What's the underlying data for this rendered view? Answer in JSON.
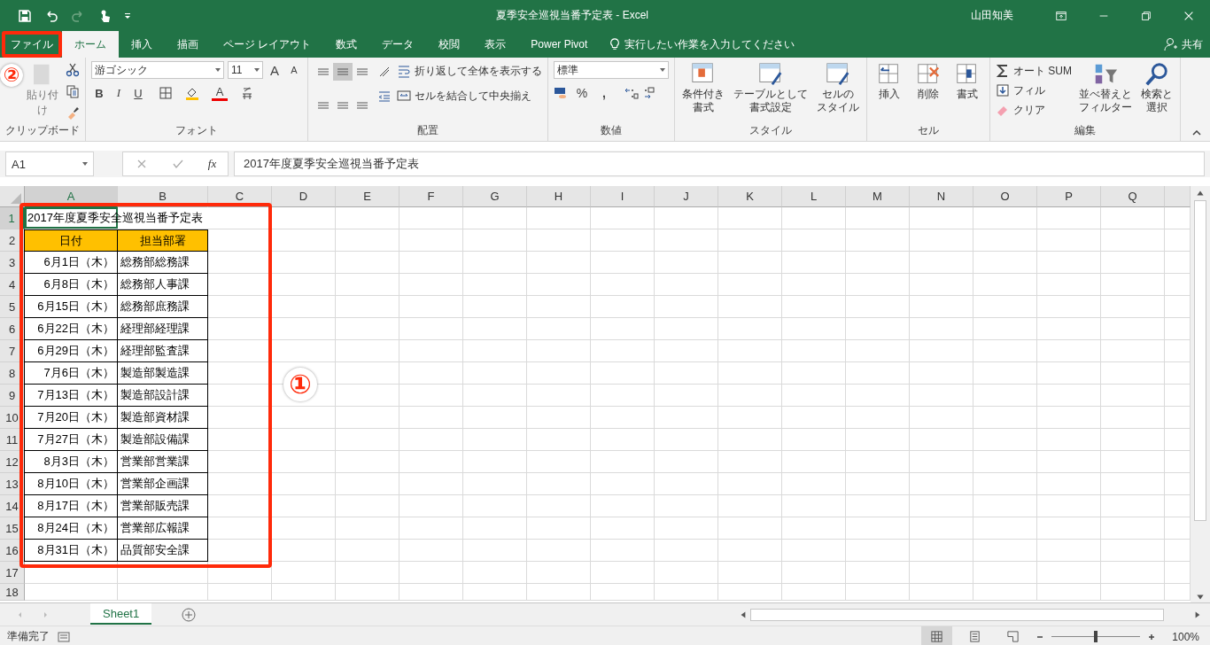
{
  "window": {
    "title": "夏季安全巡視当番予定表  -  Excel",
    "user": "山田知美"
  },
  "tabs": [
    {
      "label": "ファイル",
      "selected": false,
      "annotated": true
    },
    {
      "label": "ホーム",
      "selected": true,
      "annotated": false
    },
    {
      "label": "挿入",
      "selected": false,
      "annotated": false
    },
    {
      "label": "描画",
      "selected": false,
      "annotated": false
    },
    {
      "label": "ページ レイアウト",
      "selected": false,
      "annotated": false
    },
    {
      "label": "数式",
      "selected": false,
      "annotated": false
    },
    {
      "label": "データ",
      "selected": false,
      "annotated": false
    },
    {
      "label": "校閲",
      "selected": false,
      "annotated": false
    },
    {
      "label": "表示",
      "selected": false,
      "annotated": false
    },
    {
      "label": "Power Pivot",
      "selected": false,
      "annotated": false
    }
  ],
  "tell_me": {
    "placeholder": "実行したい作業を入力してください"
  },
  "share": "共有",
  "ribbon": {
    "clipboard": {
      "paste": "貼り付け",
      "label": "クリップボード"
    },
    "font": {
      "name": "游ゴシック",
      "size": "11",
      "grow": "A",
      "shrink": "A",
      "bold": "B",
      "italic": "I",
      "underline": "U",
      "text_color_letter": "A",
      "label": "フォント"
    },
    "alignment": {
      "wrap": "折り返して全体を表示する",
      "merge": "セルを結合して中央揃え",
      "label": "配置"
    },
    "number": {
      "format": "標準",
      "percent": "%",
      "comma": ",",
      "label": "数値"
    },
    "styles": {
      "buttons": [
        {
          "lines": [
            "条件付き",
            "書式"
          ]
        },
        {
          "lines": [
            "テーブルとして",
            "書式設定"
          ]
        },
        {
          "lines": [
            "セルの",
            "スタイル"
          ]
        }
      ],
      "label": "スタイル"
    },
    "cells": {
      "buttons": [
        "挿入",
        "削除",
        "書式"
      ],
      "label": "セル"
    },
    "editing": {
      "autosum": "オート SUM",
      "fill": "フィル",
      "clear": "クリア",
      "buttons": [
        {
          "lines": [
            "並べ替えと",
            "フィルター"
          ]
        },
        {
          "lines": [
            "検索と",
            "選択"
          ]
        }
      ],
      "label": "編集"
    }
  },
  "formula_bar": {
    "name_box": "A1",
    "fx": "fx",
    "formula": "2017年度夏季安全巡視当番予定表"
  },
  "sheet": {
    "columns": [
      {
        "label": "A",
        "selected": true
      },
      {
        "label": "B",
        "selected": false
      },
      {
        "label": "C",
        "selected": false
      },
      {
        "label": "D",
        "selected": false
      },
      {
        "label": "E",
        "selected": false
      },
      {
        "label": "F",
        "selected": false
      },
      {
        "label": "G",
        "selected": false
      },
      {
        "label": "H",
        "selected": false
      },
      {
        "label": "I",
        "selected": false
      },
      {
        "label": "J",
        "selected": false
      },
      {
        "label": "K",
        "selected": false
      },
      {
        "label": "L",
        "selected": false
      },
      {
        "label": "M",
        "selected": false
      },
      {
        "label": "N",
        "selected": false
      },
      {
        "label": "O",
        "selected": false
      },
      {
        "label": "P",
        "selected": false
      },
      {
        "label": "Q",
        "selected": false
      }
    ],
    "rows": [
      {
        "number": "1",
        "selected": true
      },
      {
        "number": "2",
        "selected": false
      },
      {
        "number": "3",
        "selected": false
      },
      {
        "number": "4",
        "selected": false
      },
      {
        "number": "5",
        "selected": false
      },
      {
        "number": "6",
        "selected": false
      },
      {
        "number": "7",
        "selected": false
      },
      {
        "number": "8",
        "selected": false
      },
      {
        "number": "9",
        "selected": false
      },
      {
        "number": "10",
        "selected": false
      },
      {
        "number": "11",
        "selected": false
      },
      {
        "number": "12",
        "selected": false
      },
      {
        "number": "13",
        "selected": false
      },
      {
        "number": "14",
        "selected": false
      },
      {
        "number": "15",
        "selected": false
      },
      {
        "number": "16",
        "selected": false
      },
      {
        "number": "17",
        "selected": false
      },
      {
        "number": "18",
        "selected": false
      }
    ]
  },
  "table": {
    "title": "2017年度夏季安全巡視当番予定表",
    "headers": [
      "日付",
      "担当部署"
    ],
    "rows": [
      {
        "date": "6月1日（木）",
        "dept": "総務部総務課"
      },
      {
        "date": "6月8日（木）",
        "dept": "総務部人事課"
      },
      {
        "date": "6月15日（木）",
        "dept": "総務部庶務課"
      },
      {
        "date": "6月22日（木）",
        "dept": "経理部経理課"
      },
      {
        "date": "6月29日（木）",
        "dept": "経理部監査課"
      },
      {
        "date": "7月6日（木）",
        "dept": "製造部製造課"
      },
      {
        "date": "7月13日（木）",
        "dept": "製造部設計課"
      },
      {
        "date": "7月20日（木）",
        "dept": "製造部資材課"
      },
      {
        "date": "7月27日（木）",
        "dept": "製造部設備課"
      },
      {
        "date": "8月3日（木）",
        "dept": "営業部営業課"
      },
      {
        "date": "8月10日（木）",
        "dept": "営業部企画課"
      },
      {
        "date": "8月17日（木）",
        "dept": "営業部販売課"
      },
      {
        "date": "8月24日（木）",
        "dept": "営業部広報課"
      },
      {
        "date": "8月31日（木）",
        "dept": "品質部安全課"
      }
    ]
  },
  "sheet_tabs": [
    {
      "label": "Sheet1",
      "selected": true
    }
  ],
  "status_bar": {
    "text": "準備完了",
    "zoom": "100%",
    "zoom_slider": {
      "level": 0.5
    }
  },
  "annotations": [
    {
      "label": "①"
    },
    {
      "label": "②"
    }
  ]
}
